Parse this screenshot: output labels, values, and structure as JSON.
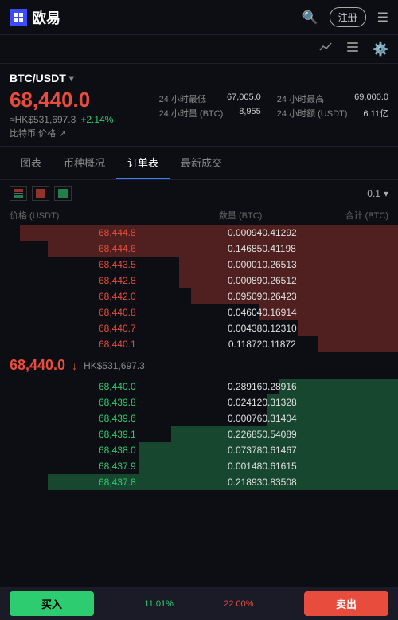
{
  "header": {
    "logo_text": "欧易",
    "register_label": "注册",
    "menu_icon": "☰",
    "search_icon": "🔍"
  },
  "sub_header": {
    "chart_icon": "📈",
    "list_icon": "📋",
    "settings_icon": "⚙"
  },
  "price_info": {
    "pair": "BTC/USDT",
    "main_price": "68,440.0",
    "hkd_price": "≈HK$531,697.3",
    "change": "+2.14%",
    "label": "比特币 价格",
    "low_24h_label": "24 小时最低",
    "low_24h_value": "67,005.0",
    "high_24h_label": "24 小时最高",
    "high_24h_value": "69,000.0",
    "vol_btc_label": "24 小时量 (BTC)",
    "vol_btc_value": "8,955",
    "vol_usdt_label": "24 小时额 (USDT)",
    "vol_usdt_value": "6.11亿"
  },
  "tabs": {
    "items": [
      "图表",
      "币种概况",
      "订单表",
      "最新成交"
    ],
    "active_index": 2
  },
  "order_book": {
    "toolbar": {
      "precision_label": "0.1"
    },
    "header": {
      "col1": "价格 (USDT)",
      "col2": "数量 (BTC)",
      "col3": "合计 (BTC)"
    },
    "asks": [
      {
        "price": "68,444.8",
        "qty": "0.00094",
        "total": "0.41292",
        "bar_pct": 95
      },
      {
        "price": "68,444.6",
        "qty": "0.14685",
        "total": "0.41198",
        "bar_pct": 88
      },
      {
        "price": "68,443.5",
        "qty": "0.00001",
        "total": "0.26513",
        "bar_pct": 55
      },
      {
        "price": "68,442.8",
        "qty": "0.00089",
        "total": "0.26512",
        "bar_pct": 55
      },
      {
        "price": "68,442.0",
        "qty": "0.09509",
        "total": "0.26423",
        "bar_pct": 52
      },
      {
        "price": "68,440.8",
        "qty": "0.04604",
        "total": "0.16914",
        "bar_pct": 35
      },
      {
        "price": "68,440.7",
        "qty": "0.00438",
        "total": "0.12310",
        "bar_pct": 25
      },
      {
        "price": "68,440.1",
        "qty": "0.11872",
        "total": "0.11872",
        "bar_pct": 20
      }
    ],
    "mid": {
      "price": "68,440.0",
      "hkd": "HK$531,697.3",
      "arrow": "↓"
    },
    "bids": [
      {
        "price": "68,440.0",
        "qty": "0.28916",
        "total": "0.28916",
        "bar_pct": 30
      },
      {
        "price": "68,439.8",
        "qty": "0.02412",
        "total": "0.31328",
        "bar_pct": 33
      },
      {
        "price": "68,439.6",
        "qty": "0.00076",
        "total": "0.31404",
        "bar_pct": 33
      },
      {
        "price": "68,439.1",
        "qty": "0.22685",
        "total": "0.54089",
        "bar_pct": 57
      },
      {
        "price": "68,438.0",
        "qty": "0.07378",
        "total": "0.61467",
        "bar_pct": 65
      },
      {
        "price": "68,437.9",
        "qty": "0.00148",
        "total": "0.61615",
        "bar_pct": 65
      },
      {
        "price": "68,437.8",
        "qty": "0.21893",
        "total": "0.83508",
        "bar_pct": 88
      }
    ]
  },
  "bottom": {
    "buy_label": "买入",
    "sell_label": "卖出",
    "left_percent": "11.01%",
    "right_percent": "22.00%"
  }
}
